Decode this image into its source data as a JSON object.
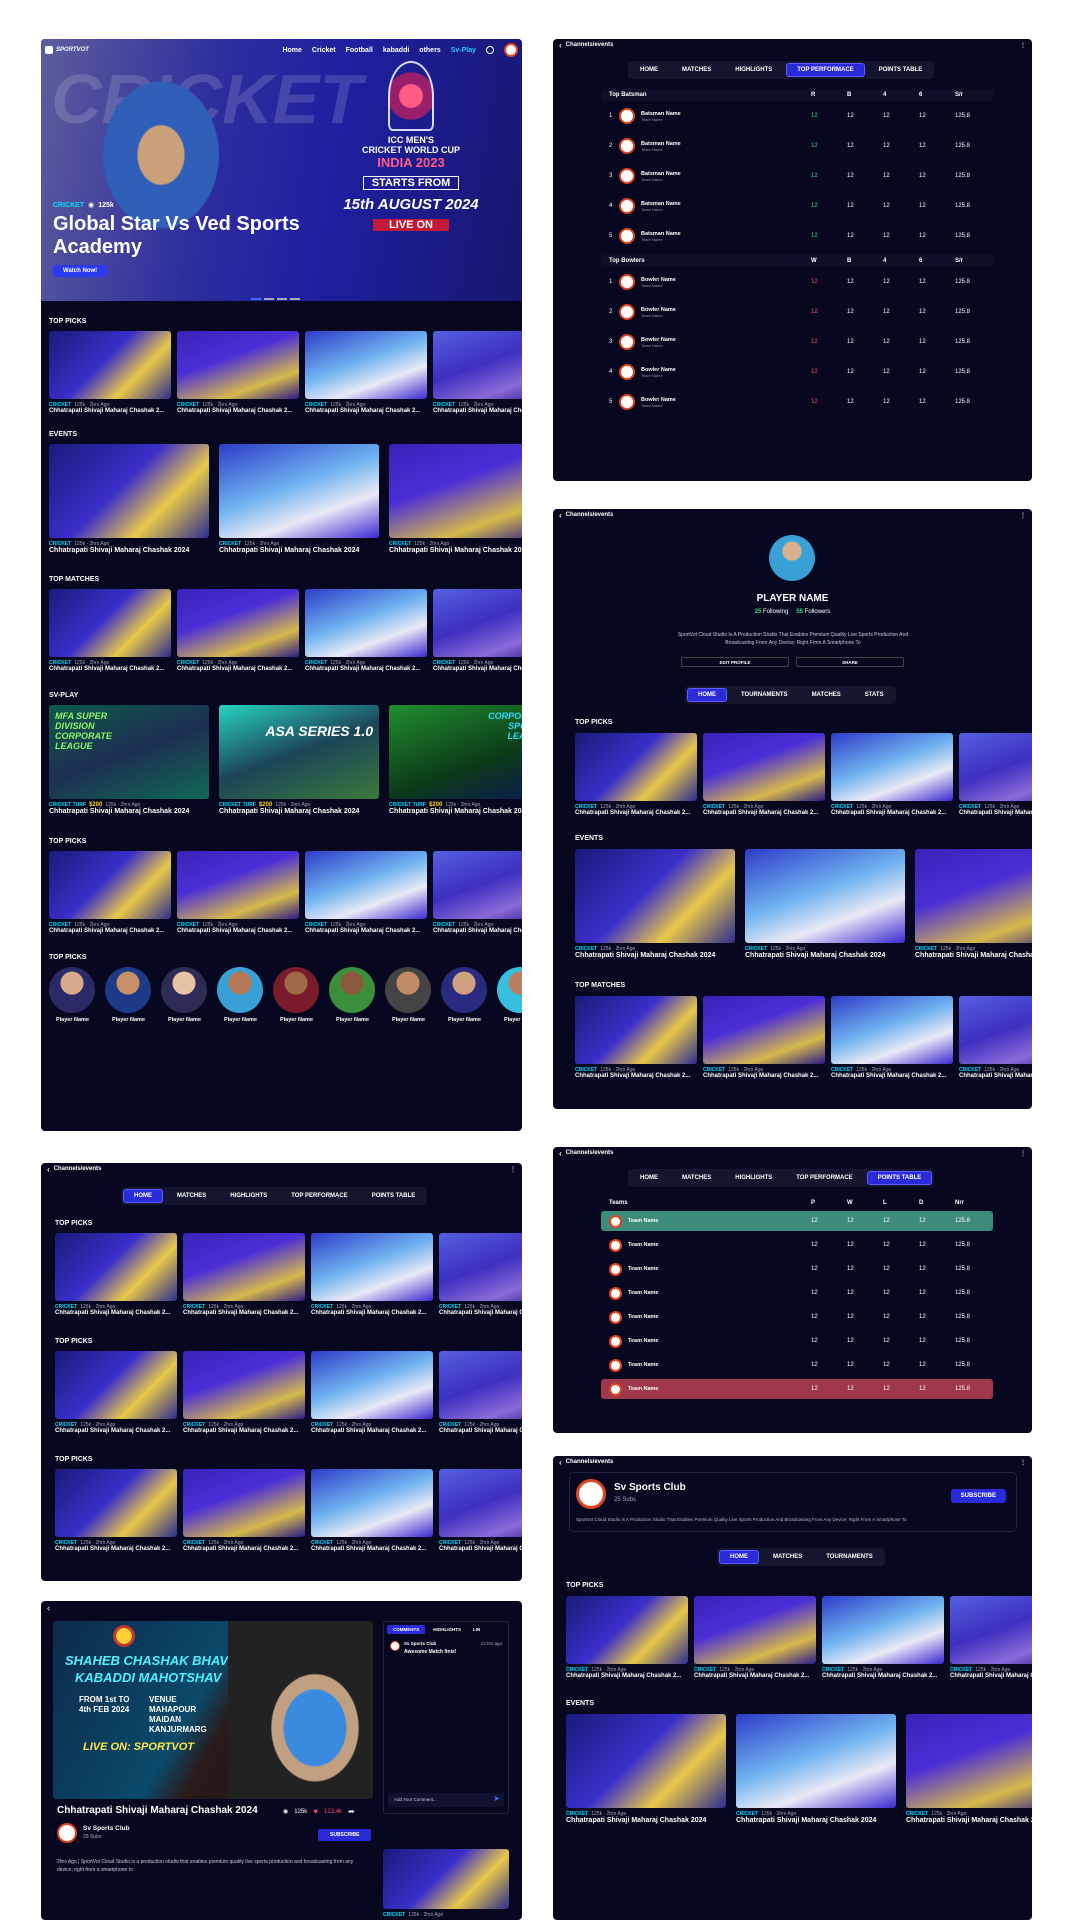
{
  "home": {
    "brand": "SPORTVOT",
    "nav": [
      "Home",
      "Cricket",
      "Football",
      "kabaddi",
      "others",
      "Sv-Play"
    ],
    "hero": {
      "category": "CRICKET",
      "views": "125k",
      "title": "Global Star Vs Ved Sports Academy",
      "button": "Watch Now!",
      "poster_lines": [
        "ICC MEN'S",
        "CRICKET WORLD CUP",
        "INDIA 2023",
        "STARTS FROM",
        "15th AUGUST 2024",
        "LIVE ON"
      ]
    },
    "sections": [
      "TOP PICKS",
      "EVENTS",
      "TOP MATCHES",
      "SV-PLAY",
      "TOP PICKS",
      "TOP PICKS"
    ],
    "card_cat": "CRICKET",
    "card_meta": "125k · 2hrs Ago",
    "card_title": "Chhatrapati Shivaji Maharaj Chashak 2...",
    "event_title": "Chhatrapati Shivaji Maharaj Chashak 2024",
    "svplay": {
      "cat": "CRICKET TURF",
      "price": "$200",
      "meta": "125k · 2hrs Ago",
      "posters": [
        "MFA SUPER DIVISION CORPORATE LEAGUE",
        "ASA SERIES 1.0",
        "CORPORATE SPORTS LEAGUE"
      ]
    },
    "player_label": "Player Name"
  },
  "perf": {
    "breadcrumb": "Channels/events",
    "tabs": [
      "HOME",
      "MATCHES",
      "HIGHLIGHTS",
      "TOP PERFORMACE",
      "POINTS TABLE"
    ],
    "bat_head": [
      "Top Batsman",
      "R",
      "B",
      "4",
      "6",
      "S/r"
    ],
    "bowl_head": [
      "Top Bowlers",
      "W",
      "B",
      "4",
      "6",
      "S/r"
    ],
    "bat_name": "Batsman Name",
    "bowl_name": "Bowler Name",
    "team_name": "Team Name",
    "val": "12",
    "sr": "125.8"
  },
  "profile": {
    "breadcrumb": "Channels/events",
    "name": "PLAYER NAME",
    "following": "25",
    "following_label": "Following",
    "followers": "55",
    "followers_label": "Followers",
    "bio": "SportVot Cloud Studio Is A Production Studio That Enables Premium Quality Live Sports Production And Broadcasting From Any Device; Right From A Smartphone To",
    "edit": "EDIT PROFILE",
    "share": "SHARE",
    "tabs": [
      "HOME",
      "TOURNAMENTS",
      "MATCHES",
      "STATS"
    ],
    "sections": [
      "TOP PICKS",
      "EVENTS",
      "TOP MATCHES"
    ]
  },
  "channel": {
    "breadcrumb": "Channels/events",
    "tabs": [
      "HOME",
      "MATCHES",
      "HIGHLIGHTS",
      "TOP PERFORMACE",
      "POINTS TABLE"
    ],
    "sections": [
      "TOP PICKS",
      "TOP PICKS",
      "TOP PICKS"
    ]
  },
  "points": {
    "breadcrumb": "Channels/events",
    "tabs": [
      "HOME",
      "MATCHES",
      "HIGHLIGHTS",
      "TOP PERFORMACE",
      "POINTS TABLE"
    ],
    "head": [
      "Teams",
      "P",
      "W",
      "L",
      "D",
      "Nrr"
    ],
    "team": "Team Name",
    "val": "12",
    "nrr": "125.8"
  },
  "club": {
    "breadcrumb": "Channels/events",
    "name": "Sv Sports Club",
    "subs": "25 Subs",
    "subscribe": "SUBSCRIBE",
    "bio": "SportVot Cloud Studio Is A Production Studio That Enables Premium Quality Live Sports Production And Broadcasting From Any Device; Right From A Smartphone To",
    "tabs": [
      "HOME",
      "MATCHES",
      "TOURNAMENTS"
    ],
    "sections": [
      "TOP PICKS",
      "EVENTS"
    ]
  },
  "video": {
    "poster": [
      "SHAHEB CHASHAK BHAVYA",
      "KABADDI MAHOTSHAV",
      "FROM 1st TO 4th FEB 2024",
      "VENUE MAHAPOUR MAIDAN KANJURMARG",
      "LIVE ON: SPORTVOT"
    ],
    "title": "Chhatrapati Shivaji Maharaj Chashak 2024",
    "views": "125k",
    "likes": "123.4k",
    "channel": "Sv Sports Club",
    "subs": "25 Subs",
    "subscribe": "SUBSCRIBE",
    "desc": "2hrs Ago | SportVot Cloud Studio is a production studio that enables premium quality live sports production and broadcasting from any device; right from a smartphone to",
    "side_tabs": [
      "COMMENTS",
      "HIGHLIGHTS",
      "LIN"
    ],
    "comment_user": "Sv Sports Club",
    "comment_time": "12 hrs ago",
    "comment_text": "Awesome Match Itnis!",
    "comment_placeholder": "Add Your Comment..."
  }
}
